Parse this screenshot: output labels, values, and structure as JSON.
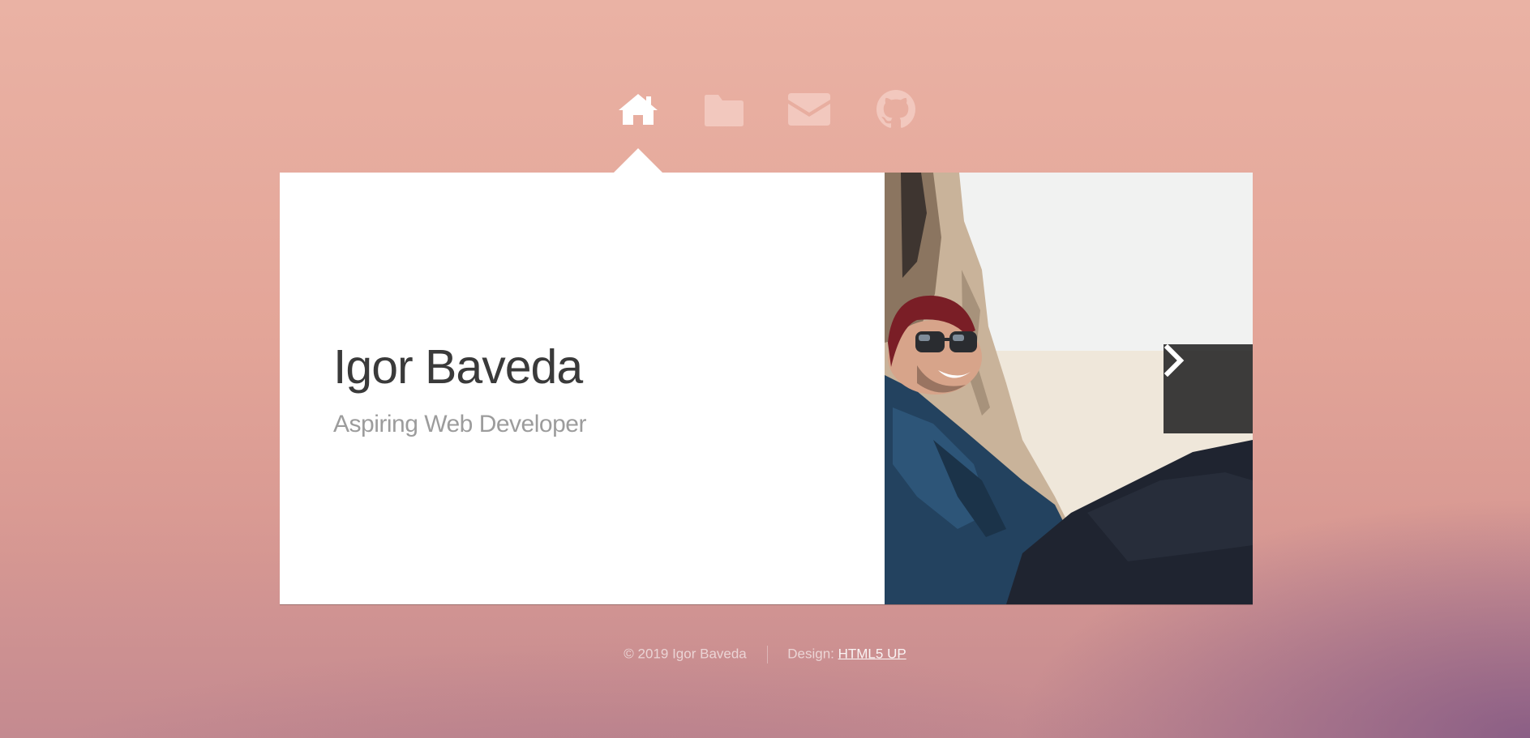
{
  "colors": {
    "background_top": "#eab2a4",
    "background_bottom": "#c48a90",
    "corner_glow": "#785082",
    "panel": "#ffffff",
    "name_text": "#3a3a3a",
    "tagline_text": "#9c9c9c",
    "nav_active": "#ffffff",
    "nav_inactive": "#f3cbc1",
    "next_button": "#232323"
  },
  "nav": {
    "items": [
      {
        "icon": "home-icon",
        "active": true
      },
      {
        "icon": "folder-icon",
        "active": false
      },
      {
        "icon": "envelope-icon",
        "active": false
      },
      {
        "icon": "github-icon",
        "active": false
      }
    ]
  },
  "intro": {
    "name": "Igor Baveda",
    "tagline": "Aspiring Web Developer"
  },
  "photo": {
    "next_icon": "chevron-right-icon"
  },
  "footer": {
    "copyright": "© 2019 Igor Baveda",
    "design_label": "Design:",
    "design_link": "HTML5 UP"
  }
}
